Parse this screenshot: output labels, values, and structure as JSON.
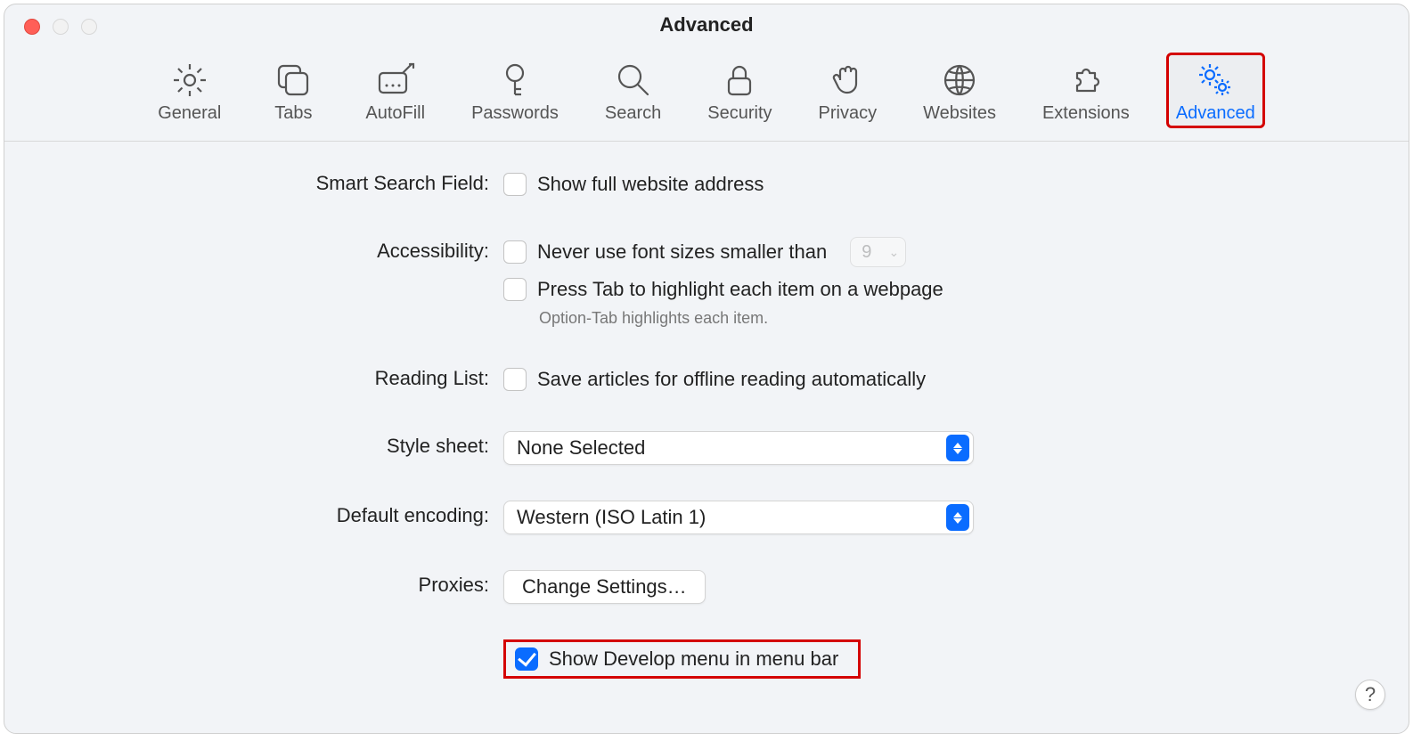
{
  "window": {
    "title": "Advanced"
  },
  "toolbar": {
    "items": [
      {
        "label": "General"
      },
      {
        "label": "Tabs"
      },
      {
        "label": "AutoFill"
      },
      {
        "label": "Passwords"
      },
      {
        "label": "Search"
      },
      {
        "label": "Security"
      },
      {
        "label": "Privacy"
      },
      {
        "label": "Websites"
      },
      {
        "label": "Extensions"
      },
      {
        "label": "Advanced"
      }
    ]
  },
  "settings": {
    "smart_search": {
      "label": "Smart Search Field:",
      "show_full_address": {
        "text": "Show full website address",
        "checked": false
      }
    },
    "accessibility": {
      "label": "Accessibility:",
      "never_smaller": {
        "text": "Never use font sizes smaller than",
        "checked": false,
        "value": "9"
      },
      "press_tab": {
        "text": "Press Tab to highlight each item on a webpage",
        "checked": false
      },
      "hint": "Option-Tab highlights each item."
    },
    "reading_list": {
      "label": "Reading List:",
      "save_offline": {
        "text": "Save articles for offline reading automatically",
        "checked": false
      }
    },
    "style_sheet": {
      "label": "Style sheet:",
      "value": "None Selected"
    },
    "default_encoding": {
      "label": "Default encoding:",
      "value": "Western (ISO Latin 1)"
    },
    "proxies": {
      "label": "Proxies:",
      "button": "Change Settings…"
    },
    "develop": {
      "text": "Show Develop menu in menu bar",
      "checked": true
    }
  },
  "help_button": "?"
}
